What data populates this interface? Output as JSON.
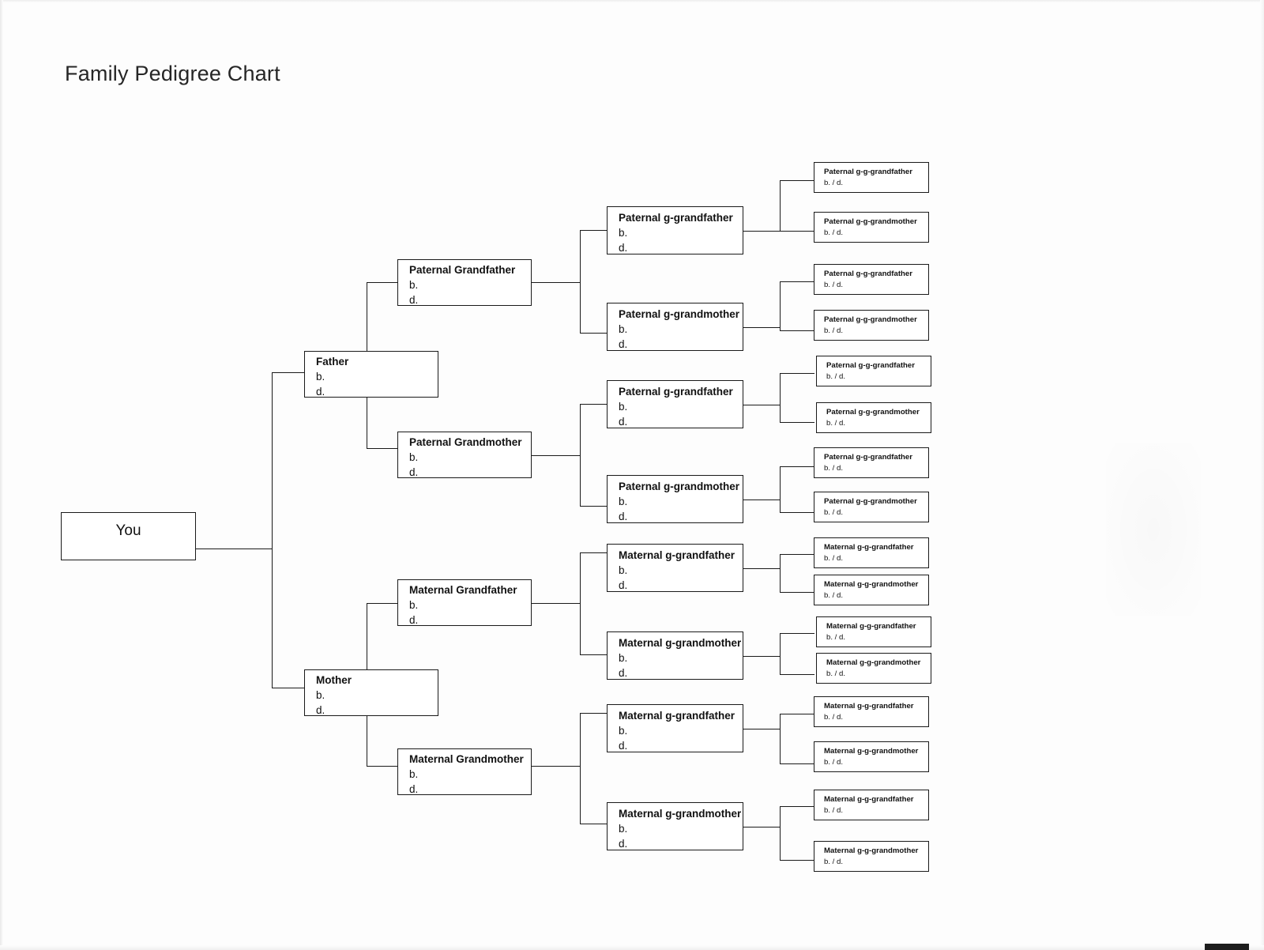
{
  "document": {
    "title": "Family Pedigree Chart",
    "type": "family-pedigree-chart",
    "generations": 5,
    "background_color": "#ffffff",
    "line_color": "#1a1a1a"
  },
  "labels": {
    "birth": "b.",
    "death": "d.",
    "birth_death_inline": "b. / d."
  },
  "nodes": {
    "you": {
      "name": "You"
    },
    "father": {
      "name": "Father",
      "birth": "b.",
      "death": "d."
    },
    "mother": {
      "name": "Mother",
      "birth": "b.",
      "death": "d."
    },
    "grandparents": [
      {
        "name": "Paternal Grandfather",
        "birth": "b.",
        "death": "d."
      },
      {
        "name": "Paternal Grandmother",
        "birth": "b.",
        "death": "d."
      },
      {
        "name": "Maternal Grandfather",
        "birth": "b.",
        "death": "d."
      },
      {
        "name": "Maternal Grandmother",
        "birth": "b.",
        "death": "d."
      }
    ],
    "great_grandparents": [
      {
        "name": "Paternal g-grandfather",
        "birth": "b.",
        "death": "d."
      },
      {
        "name": "Paternal g-grandmother",
        "birth": "b.",
        "death": "d."
      },
      {
        "name": "Paternal g-grandfather",
        "birth": "b.",
        "death": "d."
      },
      {
        "name": "Paternal g-grandmother",
        "birth": "b.",
        "death": "d."
      },
      {
        "name": "Maternal g-grandfather",
        "birth": "b.",
        "death": "d."
      },
      {
        "name": "Maternal g-grandmother",
        "birth": "b.",
        "death": "d."
      },
      {
        "name": "Maternal g-grandfather",
        "birth": "b.",
        "death": "d."
      },
      {
        "name": "Maternal g-grandmother",
        "birth": "b.",
        "death": "d."
      }
    ],
    "great_great_grandparents": [
      {
        "name": "Paternal g-g-grandfather",
        "dates": "b.  / d."
      },
      {
        "name": "Paternal g-g-grandmother",
        "dates": "b. / d."
      },
      {
        "name": "Paternal g-g-grandfather",
        "dates": "b. / d."
      },
      {
        "name": "Paternal g-g-grandmother",
        "dates": "b. / d."
      },
      {
        "name": "Paternal g-g-grandfather",
        "dates": "b. / d."
      },
      {
        "name": "Paternal g-g-grandmother",
        "dates": "b. / d."
      },
      {
        "name": "Paternal g-g-grandfather",
        "dates": "b. / d."
      },
      {
        "name": "Paternal g-g-grandmother",
        "dates": "b. / d."
      },
      {
        "name": "Maternal g-g-grandfather",
        "dates": "b. / d."
      },
      {
        "name": "Maternal g-g-grandmother",
        "dates": "b. / d."
      },
      {
        "name": "Maternal g-g-grandfather",
        "dates": "b. / d."
      },
      {
        "name": "Maternal g-g-grandmother",
        "dates": "b. / d."
      },
      {
        "name": "Maternal g-g-grandfather",
        "dates": "b. / d."
      },
      {
        "name": "Maternal g-g-grandmother",
        "dates": "b. / d."
      },
      {
        "name": "Maternal g-g-grandfather",
        "dates": "b. / d."
      },
      {
        "name": "Maternal g-g-grandmother",
        "dates": "b. / d."
      }
    ]
  }
}
